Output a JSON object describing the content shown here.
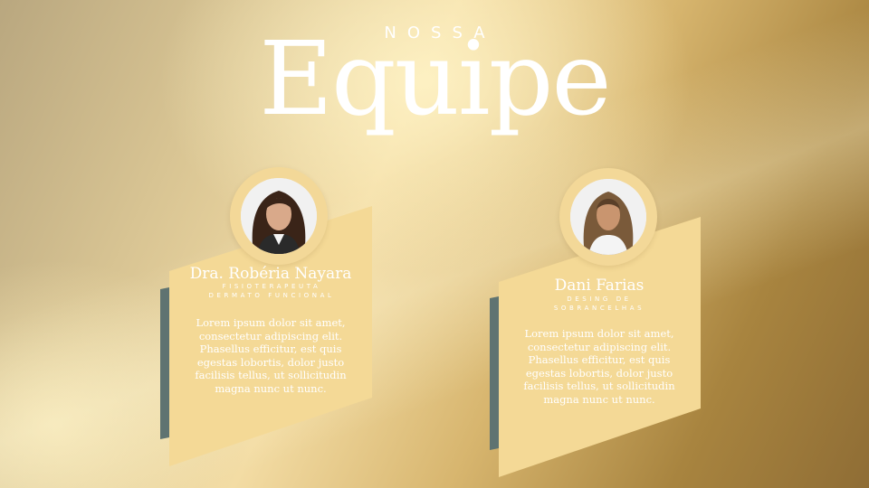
{
  "heading": {
    "small": "NOSSA",
    "big": "Equipe"
  },
  "colors": {
    "card_fill": "#f4d996",
    "card_shadow": "#5f7371",
    "text": "#ffffff"
  },
  "team": [
    {
      "name": "Dra. Robéria Nayara",
      "role": "FISIOTERAPEUTA DERMATO FUNCIONAL",
      "description": "Lorem ipsum dolor sit amet, consectetur adipiscing elit. Phasellus efficitur, est quis egestas lobortis, dolor justo facilisis tellus, ut sollicitudin magna nunc ut nunc.",
      "photo_icon": "portrait-photo"
    },
    {
      "name": "Dani Farias",
      "role": "DESING DE SOBRANCELHAS",
      "description": "Lorem ipsum dolor sit amet, consectetur adipiscing elit. Phasellus efficitur, est quis egestas lobortis, dolor justo facilisis tellus, ut sollicitudin magna nunc ut nunc.",
      "photo_icon": "portrait-photo"
    }
  ]
}
